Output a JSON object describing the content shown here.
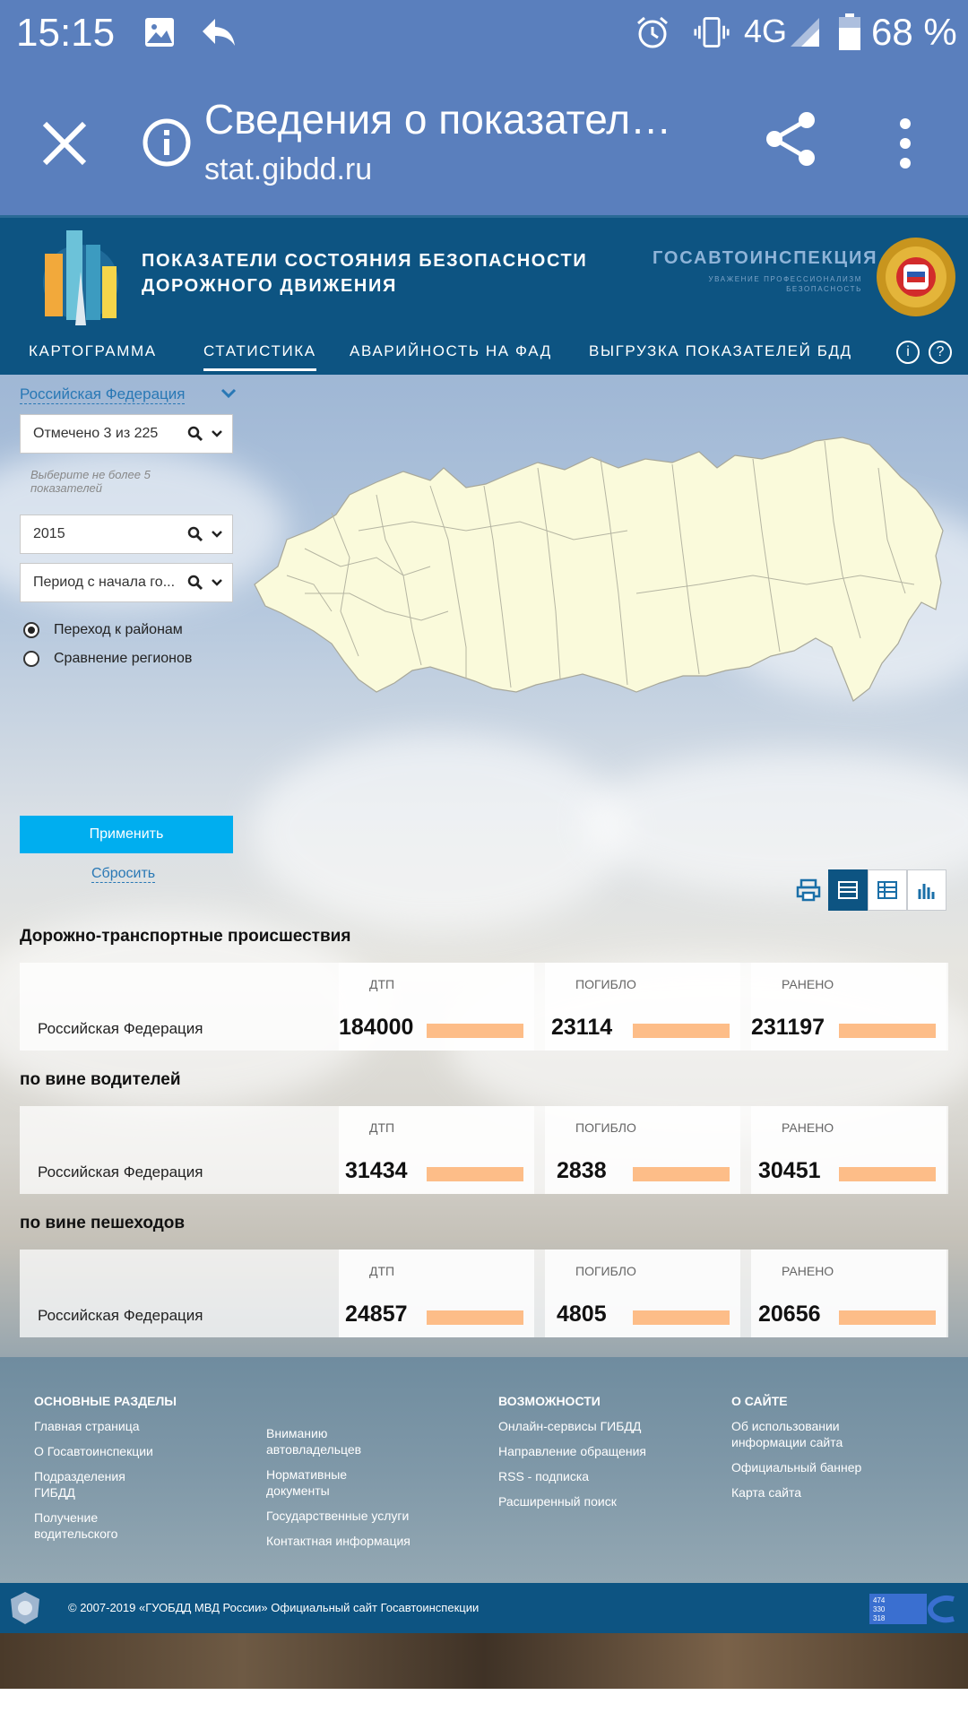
{
  "status_bar": {
    "time": "15:15",
    "network": "4G",
    "battery": "68 %"
  },
  "browser": {
    "title": "Сведения о показател…",
    "url": "stat.gibdd.ru"
  },
  "site": {
    "title_line1": "ПОКАЗАТЕЛИ СОСТОЯНИЯ БЕЗОПАСНОСТИ",
    "title_line2": "ДОРОЖНОГО ДВИЖЕНИЯ",
    "org": "ГОСАВТОИНСПЕКЦИЯ",
    "motto_line1": "УВАЖЕНИЕ ПРОФЕССИОНАЛИЗМ",
    "motto_line2": "БЕЗОПАСНОСТЬ"
  },
  "nav": [
    "КАРТОГРАММА",
    "СТАТИСТИКА",
    "АВАРИЙНОСТЬ НА ФАД",
    "ВЫГРУЗКА ПОКАЗАТЕЛЕЙ БДД"
  ],
  "filters": {
    "region": "Российская Федерация",
    "indicators": "Отмечено 3 из 225",
    "hint": "Выберите не более 5 показателей",
    "year": "2015",
    "period": "Период с начала го...",
    "radio1": "Переход к районам",
    "radio2": "Сравнение регионов",
    "apply": "Применить",
    "reset": "Сбросить"
  },
  "sections": [
    {
      "title": "Дорожно-транспортные происшествия",
      "row": "Российская Федерация",
      "cols": [
        {
          "h": "ДТП",
          "v": "184000"
        },
        {
          "h": "ПОГИБЛО",
          "v": "23114"
        },
        {
          "h": "РАНЕНО",
          "v": "231197"
        }
      ]
    },
    {
      "title": "по вине водителей",
      "row": "Российская Федерация",
      "cols": [
        {
          "h": "ДТП",
          "v": "31434"
        },
        {
          "h": "ПОГИБЛО",
          "v": "2838"
        },
        {
          "h": "РАНЕНО",
          "v": "30451"
        }
      ]
    },
    {
      "title": "по вине пешеходов",
      "row": "Российская Федерация",
      "cols": [
        {
          "h": "ДТП",
          "v": "24857"
        },
        {
          "h": "ПОГИБЛО",
          "v": "4805"
        },
        {
          "h": "РАНЕНО",
          "v": "20656"
        }
      ]
    }
  ],
  "footer": {
    "main_title": "ОСНОВНЫЕ РАЗДЕЛЫ",
    "main_links": [
      "Главная страница",
      "О Госавтоинспекции",
      "Подразделения ГИБДД",
      "Получение водительского"
    ],
    "main_links2": [
      "Вниманию автовладельцев",
      "Нормативные документы",
      "Государственные услуги",
      "Контактная информация"
    ],
    "cap_title": "ВОЗМОЖНОСТИ",
    "cap_links": [
      "Онлайн-сервисы ГИБДД",
      "Направление обращения",
      "RSS - подписка",
      "Расширенный поиск"
    ],
    "about_title": "О САЙТЕ",
    "about_links": [
      "Об использовании информации сайта",
      "Официальный баннер",
      "Карта сайта"
    ],
    "copyright": "© 2007-2019 «ГУОБДД МВД России» Официальный сайт Госавтоинспекции",
    "counter": [
      "474",
      "330",
      "318"
    ]
  }
}
